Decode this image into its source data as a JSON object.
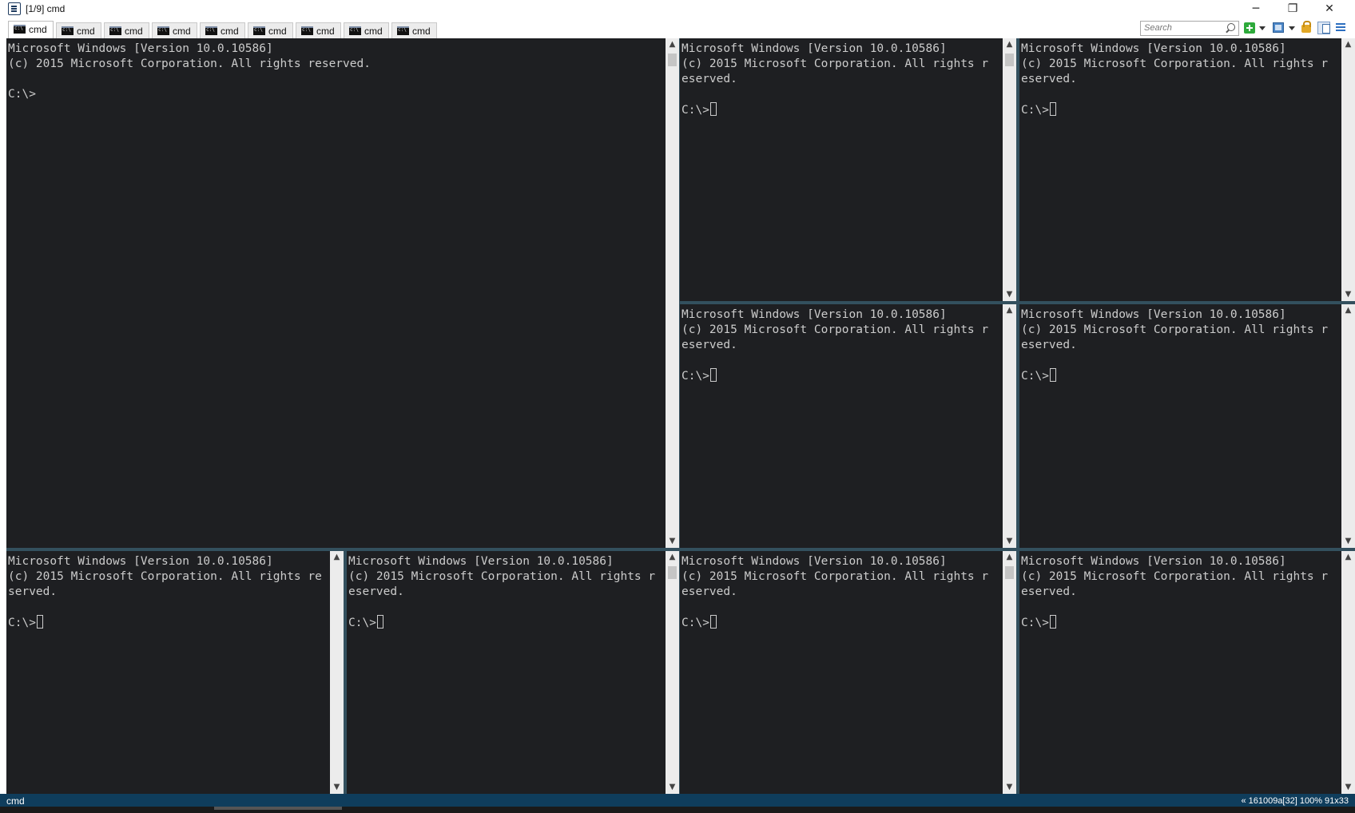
{
  "window": {
    "title": "[1/9] cmd",
    "minimize": "─",
    "maximize": "❐",
    "close": "✕"
  },
  "tabs": [
    {
      "label": "cmd",
      "active": true
    },
    {
      "label": "cmd"
    },
    {
      "label": "cmd"
    },
    {
      "label": "cmd"
    },
    {
      "label": "cmd"
    },
    {
      "label": "cmd"
    },
    {
      "label": "cmd"
    },
    {
      "label": "cmd"
    },
    {
      "label": "cmd"
    }
  ],
  "toolbar": {
    "search_placeholder": "Search",
    "icons": [
      "new-console-icon",
      "split-icon",
      "lock-icon",
      "layout-icon",
      "menu-icon"
    ]
  },
  "console": {
    "line1": "Microsoft Windows [Version 10.0.10586]",
    "line2": "(c) 2015 Microsoft Corporation. All rights reserved.",
    "prompt": "C:\\>"
  },
  "panes": [
    {
      "id": 1,
      "text": "Microsoft Windows [Version 10.0.10586]\n(c) 2015 Microsoft Corporation. All rights reserved.\n\nC:\\>",
      "active": true
    },
    {
      "id": 2,
      "text": "Microsoft Windows [Version 10.0.10586]\n(c) 2015 Microsoft Corporation. All rights r\neserved.\n\nC:\\>"
    },
    {
      "id": 3,
      "text": "Microsoft Windows [Version 10.0.10586]\n(c) 2015 Microsoft Corporation. All rights r\neserved.\n\nC:\\>"
    },
    {
      "id": 4,
      "text": "Microsoft Windows [Version 10.0.10586]\n(c) 2015 Microsoft Corporation. All rights r\neserved.\n\nC:\\>"
    },
    {
      "id": 5,
      "text": "Microsoft Windows [Version 10.0.10586]\n(c) 2015 Microsoft Corporation. All rights r\neserved.\n\nC:\\>"
    },
    {
      "id": 6,
      "text": "Microsoft Windows [Version 10.0.10586]\n(c) 2015 Microsoft Corporation. All rights re\nserved.\n\nC:\\>"
    },
    {
      "id": 7,
      "text": "Microsoft Windows [Version 10.0.10586]\n(c) 2015 Microsoft Corporation. All rights r\neserved.\n\nC:\\>"
    },
    {
      "id": 8,
      "text": "Microsoft Windows [Version 10.0.10586]\n(c) 2015 Microsoft Corporation. All rights r\neserved.\n\nC:\\>"
    },
    {
      "id": 9,
      "text": "Microsoft Windows [Version 10.0.10586]\n(c) 2015 Microsoft Corporation. All rights r\neserved.\n\nC:\\>"
    }
  ],
  "statusbar": {
    "left": "cmd",
    "right": "« 161009a[32]  100%  91x33"
  },
  "colors": {
    "console_bg": "#1e1f22",
    "console_fg": "#cccccc",
    "statusbar_bg": "#0f3d5c",
    "splitter": "#33505e"
  }
}
